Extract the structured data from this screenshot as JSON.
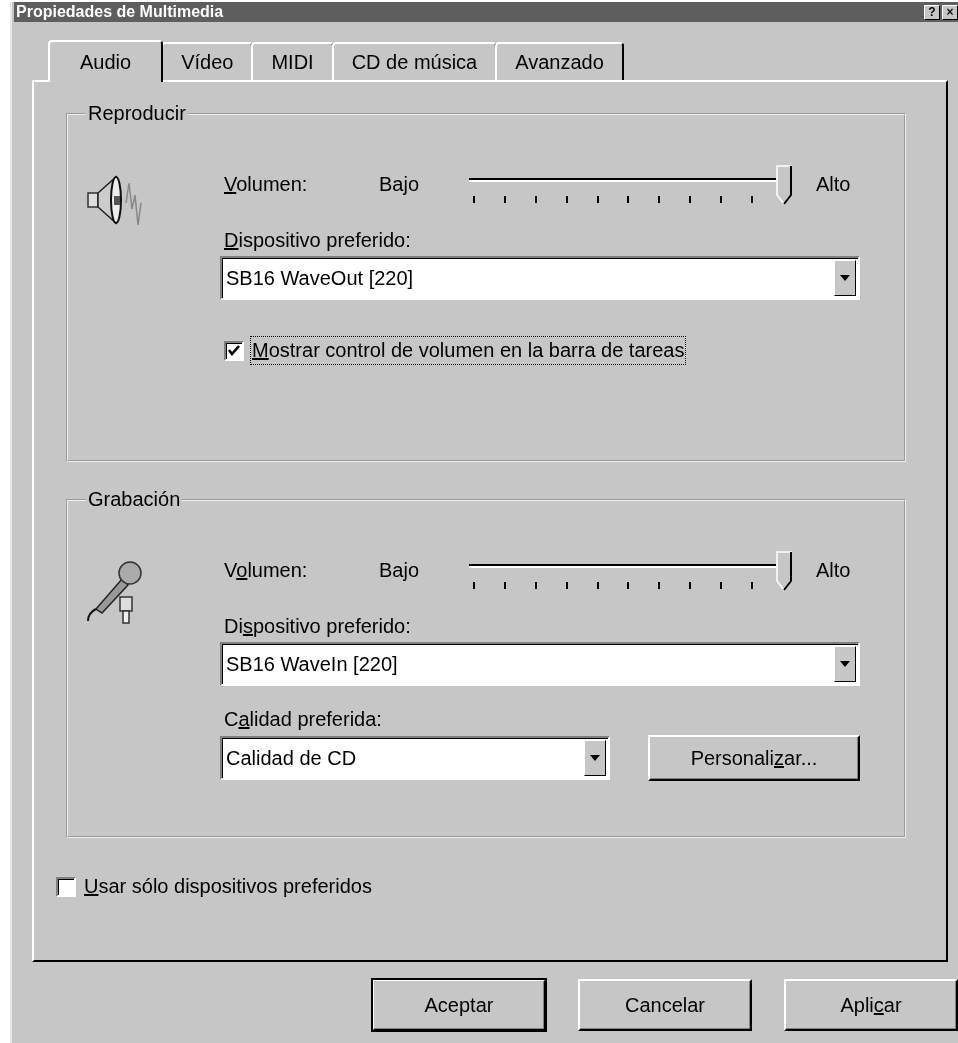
{
  "window": {
    "title": "Propiedades de Multimedia",
    "title_buttons": [
      "?",
      "×"
    ]
  },
  "tabs": [
    {
      "label": "Audio",
      "selected": true
    },
    {
      "label": "Vídeo",
      "selected": false
    },
    {
      "label": "MIDI",
      "selected": false
    },
    {
      "label": "CD de música",
      "selected": false
    },
    {
      "label": "Avanzado",
      "selected": false
    }
  ],
  "playback": {
    "legend": "Reproducir",
    "volume": {
      "label": {
        "key": "V",
        "post": "olumen:"
      },
      "low": "Bajo",
      "high": "Alto",
      "level": 1.0
    },
    "device": {
      "label": {
        "key": "D",
        "post": "ispositivo preferido:"
      },
      "value": "SB16 WaveOut [220]"
    },
    "taskbar_checkbox": {
      "label": {
        "key": "M",
        "post": "ostrar control de volumen en la barra de tareas"
      },
      "checked": true,
      "focused": true
    }
  },
  "recording": {
    "legend": "Grabación",
    "volume": {
      "label": {
        "pre": "V",
        "key": "o",
        "post": "lumen:"
      },
      "low": "Bajo",
      "high": "Alto",
      "level": 1.0
    },
    "device": {
      "label": {
        "pre": "Di",
        "key": "s",
        "post": "positivo preferido:"
      },
      "value": "SB16 WaveIn [220]"
    },
    "quality": {
      "label": {
        "pre": "C",
        "key": "a",
        "post": "lidad preferida:"
      },
      "value": "Calidad de CD"
    },
    "customize_button": {
      "pre": "Personali",
      "key": "z",
      "post": "ar..."
    }
  },
  "preferred_only_checkbox": {
    "label": {
      "key": "U",
      "post": "sar sólo dispositivos preferidos"
    },
    "checked": false,
    "focused": false
  },
  "buttons": [
    {
      "label": {
        "pre": "Aceptar"
      },
      "default": true
    },
    {
      "label": {
        "pre": "Cancelar"
      },
      "default": false
    },
    {
      "label": {
        "pre": "Apli",
        "key": "c",
        "post": "ar"
      },
      "default": false
    }
  ]
}
